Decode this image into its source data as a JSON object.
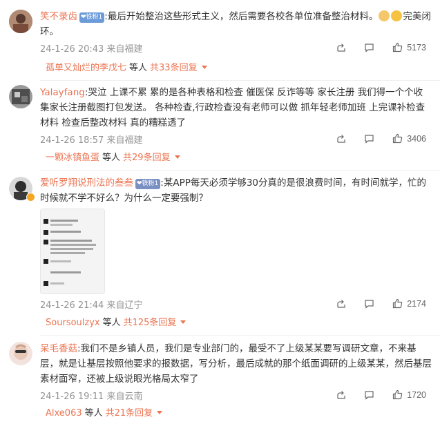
{
  "comments": [
    {
      "name": "笑不录齿",
      "badge": "铁粉1",
      "text": ":最后开始整治这些形式主义，然后需要各校各单位准备整治材料。",
      "text_after": "完美闭环。",
      "meta": "24-1-26 20:43 来自福建",
      "likes": "5173",
      "reply_name": "孤单又灿烂的李戊七",
      "reply_mid": "等人",
      "reply_total": "共33条回复",
      "avatar_color": "#8a5a4a"
    },
    {
      "name": "Yalayfang",
      "text": ":哭泣 上课不累 累的是各种表格和检查 催医保 反诈等等 家长注册 我们得一个个收集家长注册截图打包发送。 各种检查,行政检查没有老师可以做 抓年轻老师加班 上完课补检查材料 检查后整改材料 真的糟糕透了",
      "meta": "24-1-26 18:57 来自福建",
      "likes": "3406",
      "reply_name": "一颗冰镇鱼蛋",
      "reply_mid": "等人",
      "reply_total": "共29条回复",
      "avatar_color": "#6c6c6c"
    },
    {
      "name": "爱听罗翔说刑法的叁叁",
      "badge": "铁粉1",
      "text": ":某APP每天必须学够30分真的是很浪费时间，有时间就学，忙的时候就不学不好么？为什么一定要强制？",
      "meta": "24-1-26 21:44 来自辽宁",
      "likes": "2174",
      "reply_name": "Soursoulzyx",
      "reply_mid": "等人",
      "reply_total": "共125条回复",
      "avatar_color": "#3f3f3f"
    },
    {
      "name": "呆毛香菇",
      "text": ":我们不是乡镇人员，我们是专业部门的，最受不了上级某某要写调研文章，不来基层，就是让基层按照他要求的报数据，写分析，最后成就的那个纸面调研的上级某某，然后基层素材面窄，还被上级说眼光格局太窄了",
      "meta": "24-1-26 19:11 来自云南",
      "likes": "1720",
      "reply_name": "Alxe063",
      "reply_mid": "等人",
      "reply_total": "共21条回复",
      "avatar_color": "#d9b8b0"
    }
  ]
}
